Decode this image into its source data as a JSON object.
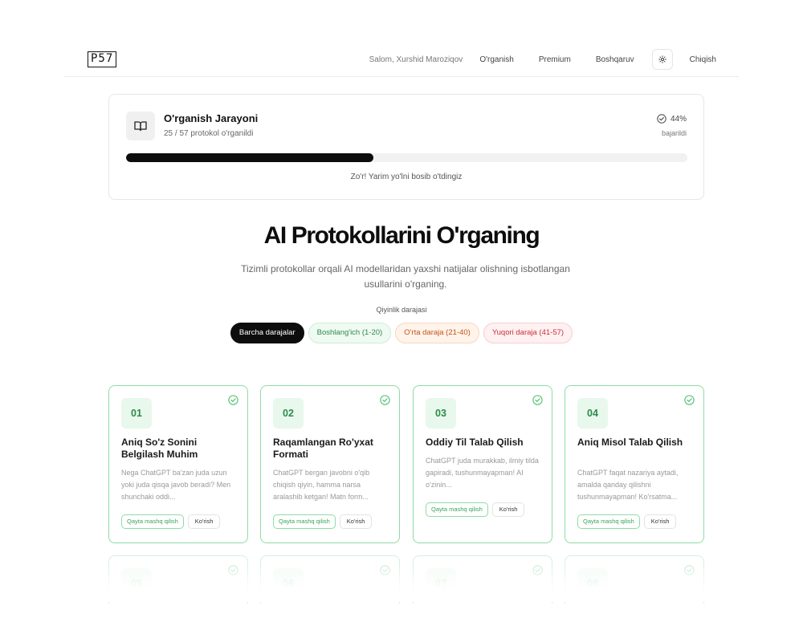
{
  "header": {
    "logo": "P57",
    "greeting": "Salom, Xurshid Maroziqov",
    "nav": [
      "O'rganish",
      "Premium",
      "Boshqaruv"
    ],
    "theme_icon": "sun-icon",
    "logout": "Chiqish"
  },
  "progress": {
    "icon": "book-icon",
    "title": "O'rganish Jarayoni",
    "subtitle": "25 / 57 protokol o'rganildi",
    "percent_label": "44%",
    "percent": 0.44,
    "done_label": "bajarildi",
    "message": "Zo'r! Yarim yo'lni bosib o'tdingiz"
  },
  "hero": {
    "title": "AI Protokollarini O'rganing",
    "subtitle": "Tizimli protokollar orqali AI modellaridan yaxshi natijalar olishning isbotlangan usullarini o'rganing."
  },
  "filters": {
    "label": "Qiyinlik darajasi",
    "options": [
      "Barcha darajalar",
      "Boshlang'ich (1-20)",
      "O'rta daraja (21-40)",
      "Yuqori daraja (41-57)"
    ],
    "selected": "Barcha darajalar"
  },
  "cards": [
    {
      "number": "01",
      "title": "Aniq So'z Sonini Belgilash Muhim",
      "desc": "Nega ChatGPT ba'zan juda uzun yoki juda qisqa javob beradi? Men shunchaki oddi...",
      "retry": "Qayta mashq qilish",
      "view": "Ko'rish",
      "completed": true
    },
    {
      "number": "02",
      "title": "Raqamlangan Ro'yxat Formati",
      "desc": "ChatGPT bergan javobni o'qib chiqish qiyin, hamma narsa aralashib ketgan! Matn form...",
      "retry": "Qayta mashq qilish",
      "view": "Ko'rish",
      "completed": true
    },
    {
      "number": "03",
      "title": "Oddiy Til Talab Qilish",
      "desc": "ChatGPT juda murakkab, ilmiy tilda gapiradi, tushunmayapman! AI o'zinin...",
      "retry": "Qayta mashq qilish",
      "view": "Ko'rish",
      "completed": true
    },
    {
      "number": "04",
      "title": "Aniq Misol Talab Qilish",
      "desc": "ChatGPT faqat nazariya aytadi, amalda qanday qilishni tushunmayapman! Ko'rsatma...",
      "retry": "Qayta mashq qilish",
      "view": "Ko'rish",
      "completed": true
    }
  ],
  "ghost_cards": [
    "05",
    "06",
    "07",
    "08"
  ]
}
